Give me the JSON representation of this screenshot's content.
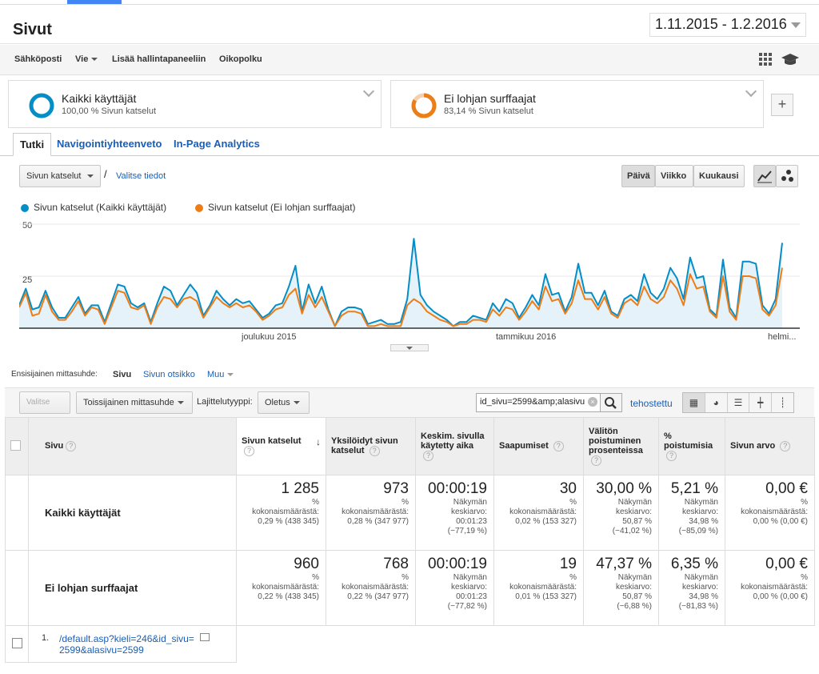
{
  "page": {
    "title": "Sivut",
    "date_range": "1.11.2015 - 1.2.2016"
  },
  "toolbar": {
    "email": "Sähköposti",
    "export": "Vie",
    "add_dashboard": "Lisää hallintapaneeliin",
    "shortcut": "Oikopolku"
  },
  "segments": [
    {
      "name": "Kaikki käyttäjät",
      "sub": "100,00 % Sivun katselut",
      "color": "#058dc7",
      "fraction": 1.0
    },
    {
      "name": "Ei lohjan surffaajat",
      "sub": "83,14 % Sivun katselut",
      "color": "#ed7e17",
      "fraction": 0.8314
    }
  ],
  "tabs": {
    "explore": "Tutki",
    "nav_summary": "Navigointiyhteenveto",
    "inpage": "In-Page Analytics"
  },
  "chart_controls": {
    "metric": "Sivun katselut",
    "slash": "/",
    "select_metric": "Valitse tiedot",
    "day": "Päivä",
    "week": "Viikko",
    "month": "Kuukausi"
  },
  "chart_data": {
    "type": "line",
    "ylabel_ticks": [
      "50",
      "25"
    ],
    "ylim": [
      0,
      50
    ],
    "x_tick_labels": [
      "joulukuu 2015",
      "tammikuu 2016",
      "helmi..."
    ],
    "series": [
      {
        "name": "Sivun katselut (Kaikki käyttäjät)",
        "color": "#058dc7",
        "values": [
          11,
          19,
          9,
          10,
          18,
          10,
          5,
          5,
          10,
          15,
          7,
          11,
          11,
          3,
          12,
          21,
          20,
          12,
          10,
          12,
          3,
          12,
          20,
          18,
          11,
          16,
          21,
          17,
          6,
          11,
          18,
          14,
          11,
          14,
          12,
          13,
          9,
          5,
          7,
          11,
          12,
          20,
          30,
          8,
          21,
          12,
          20,
          9,
          1,
          8,
          10,
          10,
          9,
          2,
          3,
          4,
          2,
          2,
          3,
          14,
          43,
          16,
          11,
          8,
          6,
          4,
          1,
          3,
          3,
          6,
          5,
          4,
          12,
          8,
          14,
          12,
          5,
          10,
          16,
          11,
          26,
          16,
          17,
          8,
          15,
          31,
          17,
          17,
          11,
          18,
          8,
          6,
          14,
          16,
          13,
          26,
          17,
          14,
          19,
          29,
          24,
          14,
          34,
          24,
          25,
          9,
          6,
          33,
          10,
          5,
          32,
          32,
          31,
          11,
          7,
          14,
          41
        ]
      },
      {
        "name": "Sivun katselut (Ei lohjan surffaajat)",
        "color": "#ed7e17",
        "values": [
          10,
          17,
          6,
          7,
          16,
          8,
          4,
          4,
          8,
          13,
          6,
          10,
          9,
          2,
          10,
          18,
          17,
          10,
          9,
          11,
          2,
          10,
          15,
          14,
          10,
          14,
          15,
          13,
          5,
          10,
          15,
          12,
          10,
          12,
          10,
          11,
          8,
          4,
          6,
          9,
          10,
          16,
          19,
          7,
          16,
          10,
          15,
          8,
          1,
          6,
          8,
          8,
          7,
          1,
          1,
          2,
          1,
          1,
          1,
          11,
          14,
          12,
          8,
          6,
          4,
          3,
          1,
          2,
          2,
          4,
          4,
          3,
          9,
          6,
          10,
          9,
          4,
          8,
          13,
          9,
          20,
          13,
          14,
          7,
          12,
          23,
          14,
          14,
          9,
          15,
          7,
          5,
          12,
          14,
          11,
          20,
          14,
          12,
          15,
          23,
          19,
          11,
          26,
          19,
          20,
          8,
          5,
          25,
          8,
          4,
          25,
          25,
          24,
          9,
          6,
          11,
          29
        ]
      }
    ]
  },
  "dimensions": {
    "label": "Ensisijainen mittasuhde:",
    "page": "Sivu",
    "page_title": "Sivun otsikko",
    "other": "Muu"
  },
  "table_controls": {
    "plot_rows": "Valitse rivit",
    "secondary": "Toissijainen mittasuhde",
    "sort_type_label": "Lajittelutyyppi:",
    "sort_type": "Oletus",
    "search_value": "id_sivu=2599&amp;alasivu",
    "advanced": "tehostettu"
  },
  "table": {
    "headers": [
      "Sivu",
      "Sivun katselut",
      "Yksilöidyt sivun katselut",
      "Keskim. sivulla käytetty aika",
      "Saapumiset",
      "Välitön poistuminen prosenteissa",
      "% poistumisia",
      "Sivun arvo"
    ],
    "rows": [
      {
        "label": "Kaikki käyttäjät",
        "cells": [
          {
            "v": "1 285",
            "s": [
              "%",
              "kokonaismäärästä:",
              "0,29 % (438 345)"
            ]
          },
          {
            "v": "973",
            "s": [
              "%",
              "kokonaismäärästä:",
              "0,28 % (347 977)"
            ]
          },
          {
            "v": "00:00:19",
            "s": [
              "Näkymän",
              "keskiarvo:",
              "00:01:23",
              "(−77,19 %)"
            ]
          },
          {
            "v": "30",
            "s": [
              "%",
              "kokonaismäärästä:",
              "0,02 % (153 327)"
            ]
          },
          {
            "v": "30,00 %",
            "s": [
              "Näkymän",
              "keskiarvo:",
              "50,87 %",
              "(−41,02 %)"
            ]
          },
          {
            "v": "5,21 %",
            "s": [
              "Näkymän",
              "keskiarvo:",
              "34,98 %",
              "(−85,09 %)"
            ]
          },
          {
            "v": "0,00 €",
            "s": [
              "%",
              "kokonaismäärästä:",
              "0,00 % (0,00 €)"
            ]
          }
        ]
      },
      {
        "label": "Ei lohjan surffaajat",
        "cells": [
          {
            "v": "960",
            "s": [
              "%",
              "kokonaismäärästä:",
              "0,22 % (438 345)"
            ]
          },
          {
            "v": "768",
            "s": [
              "%",
              "kokonaismäärästä:",
              "0,22 % (347 977)"
            ]
          },
          {
            "v": "00:00:19",
            "s": [
              "Näkymän",
              "keskiarvo:",
              "00:01:23",
              "(−77,82 %)"
            ]
          },
          {
            "v": "19",
            "s": [
              "%",
              "kokonaismäärästä:",
              "0,01 % (153 327)"
            ]
          },
          {
            "v": "47,37 %",
            "s": [
              "Näkymän",
              "keskiarvo:",
              "50,87 %",
              "(−6,88 %)"
            ]
          },
          {
            "v": "6,35 %",
            "s": [
              "Näkymän",
              "keskiarvo:",
              "34,98 %",
              "(−81,83 %)"
            ]
          },
          {
            "v": "0,00 €",
            "s": [
              "%",
              "kokonaismäärästä:",
              "0,00 % (0,00 €)"
            ]
          }
        ]
      }
    ],
    "page_row": {
      "index": "1.",
      "url": "/default.asp?kieli=246&id_sivu=2599&alasivu=2599"
    }
  }
}
